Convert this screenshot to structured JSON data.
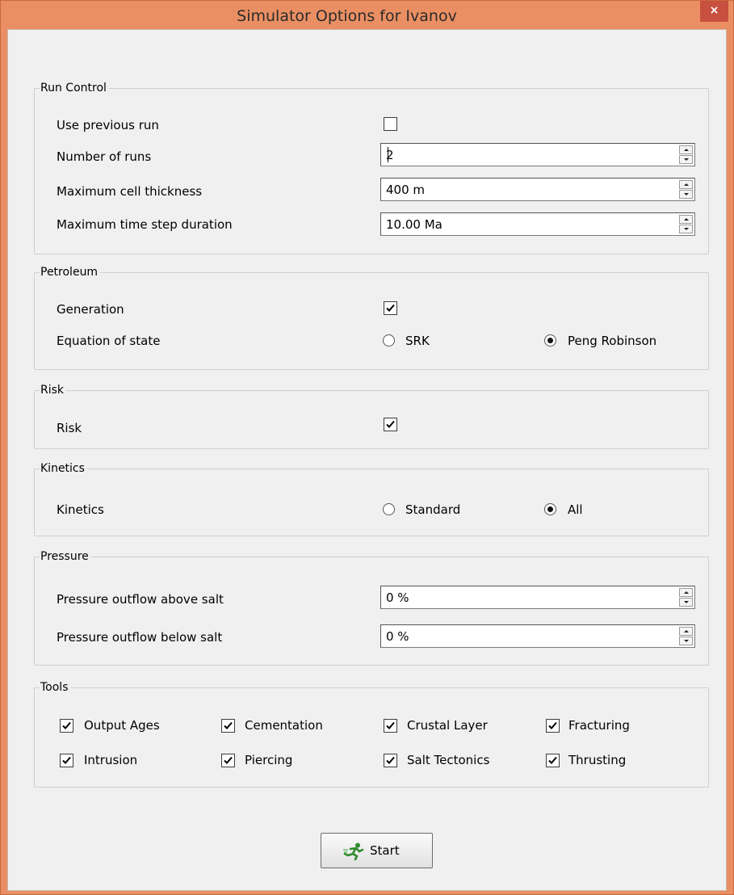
{
  "window": {
    "title": "Simulator Options for Ivanov",
    "close_glyph": "×"
  },
  "run_control": {
    "legend": "Run Control",
    "use_previous_run": {
      "label": "Use previous run",
      "checked": false
    },
    "number_of_runs": {
      "label": "Number of runs",
      "value": "2"
    },
    "max_cell_thickness": {
      "label": "Maximum cell thickness",
      "value": "400 m"
    },
    "max_time_step": {
      "label": "Maximum time step duration",
      "value": "10.00 Ma"
    }
  },
  "petroleum": {
    "legend": "Petroleum",
    "generation": {
      "label": "Generation",
      "checked": true
    },
    "equation_of_state": {
      "label": "Equation of state",
      "options": [
        "SRK",
        "Peng Robinson"
      ],
      "selected": "Peng Robinson"
    }
  },
  "risk": {
    "legend": "Risk",
    "risk": {
      "label": "Risk",
      "checked": true
    }
  },
  "kinetics": {
    "legend": "Kinetics",
    "kinetics": {
      "label": "Kinetics",
      "options": [
        "Standard",
        "All"
      ],
      "selected": "All"
    }
  },
  "pressure": {
    "legend": "Pressure",
    "above_salt": {
      "label": "Pressure outflow above salt",
      "value": "0 %"
    },
    "below_salt": {
      "label": "Pressure outflow below salt",
      "value": "0 %"
    }
  },
  "tools": {
    "legend": "Tools",
    "items": [
      {
        "label": "Output Ages",
        "checked": true
      },
      {
        "label": "Cementation",
        "checked": true
      },
      {
        "label": "Crustal Layer",
        "checked": true
      },
      {
        "label": "Fracturing",
        "checked": true
      },
      {
        "label": "Intrusion",
        "checked": true
      },
      {
        "label": "Piercing",
        "checked": true
      },
      {
        "label": "Salt Tectonics",
        "checked": true
      },
      {
        "label": "Thrusting",
        "checked": true
      }
    ]
  },
  "actions": {
    "start_label": "Start",
    "start_icon": "running-man-icon"
  },
  "colors": {
    "title_bar": "#ea8f63",
    "close_button": "#c7503e",
    "dialog_background": "#f0f0f0"
  }
}
